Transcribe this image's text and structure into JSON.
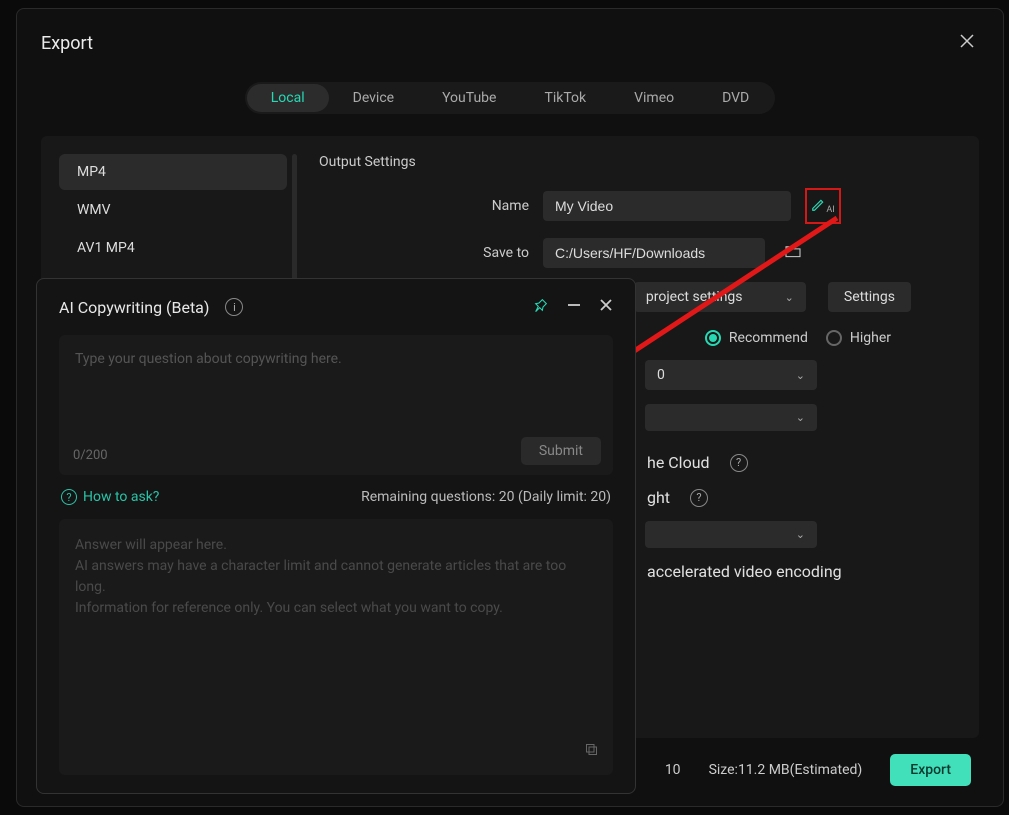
{
  "dialog": {
    "title": "Export"
  },
  "tabs": {
    "items": [
      "Local",
      "Device",
      "YouTube",
      "TikTok",
      "Vimeo",
      "DVD"
    ],
    "active": "Local"
  },
  "formats": {
    "items": [
      "MP4",
      "WMV",
      "AV1 MP4"
    ],
    "active": "MP4"
  },
  "output": {
    "section_title": "Output Settings",
    "name_label": "Name",
    "name_value": "My Video",
    "saveto_label": "Save to",
    "saveto_value": "C:/Users/HF/Downloads",
    "preset_value": "project settings",
    "settings_btn": "Settings",
    "quality_recommend": "Recommend",
    "quality_higher": "Higher",
    "partial_num": "0",
    "cloud_text": "he Cloud",
    "ght_text": "ght",
    "encoding_text": "accelerated video encoding"
  },
  "footer": {
    "left_num": "10",
    "size_label": "Size:",
    "size_value": "11.2 MB",
    "size_suffix": "(Estimated)",
    "export_btn": "Export"
  },
  "ai": {
    "title": "AI Copywriting (Beta)",
    "placeholder": "Type your question about copywriting here.",
    "char_count": "0/200",
    "submit": "Submit",
    "how_to": "How to ask?",
    "remaining": "Remaining questions: 20 (Daily limit: 20)",
    "answer_line1": "Answer will appear here.",
    "answer_line2": "AI answers may have a character limit and cannot generate articles that are too long.",
    "answer_line3": "Information for reference only. You can select what you want to copy."
  }
}
